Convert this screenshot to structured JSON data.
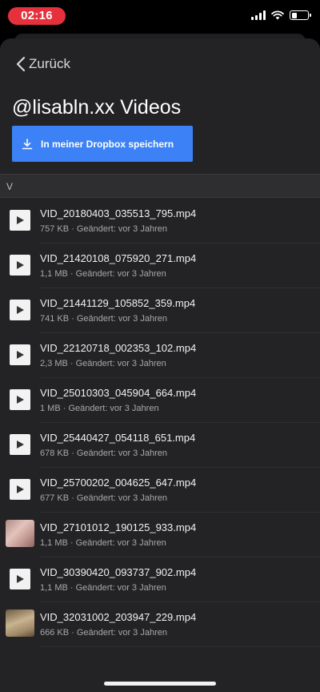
{
  "status_bar": {
    "time": "02:16"
  },
  "nav": {
    "back_label": "Zurück"
  },
  "page": {
    "title": "@lisabln.xx Videos"
  },
  "actions": {
    "save_label": "In meiner Dropbox speichern",
    "accent_color": "#3c82f6"
  },
  "section": {
    "label": "V"
  },
  "files": [
    {
      "name": "VID_20180403_035513_795.mp4",
      "meta": "757 KB · Geändert: vor 3 Jahren",
      "thumb": "play-icon"
    },
    {
      "name": "VID_21420108_075920_271.mp4",
      "meta": "1,1 MB · Geändert: vor 3 Jahren",
      "thumb": "play-icon"
    },
    {
      "name": "VID_21441129_105852_359.mp4",
      "meta": "741 KB · Geändert: vor 3 Jahren",
      "thumb": "play-icon"
    },
    {
      "name": "VID_22120718_002353_102.mp4",
      "meta": "2,3 MB · Geändert: vor 3 Jahren",
      "thumb": "play-icon"
    },
    {
      "name": "VID_25010303_045904_664.mp4",
      "meta": "1 MB · Geändert: vor 3 Jahren",
      "thumb": "play-icon"
    },
    {
      "name": "VID_25440427_054118_651.mp4",
      "meta": "678 KB · Geändert: vor 3 Jahren",
      "thumb": "play-icon"
    },
    {
      "name": "VID_25700202_004625_647.mp4",
      "meta": "677 KB · Geändert: vor 3 Jahren",
      "thumb": "play-icon"
    },
    {
      "name": "VID_27101012_190125_933.mp4",
      "meta": "1,1 MB · Geändert: vor 3 Jahren",
      "thumb": "video-thumbnail"
    },
    {
      "name": "VID_30390420_093737_902.mp4",
      "meta": "1,1 MB · Geändert: vor 3 Jahren",
      "thumb": "play-icon"
    },
    {
      "name": "VID_32031002_203947_229.mp4",
      "meta": "666 KB · Geändert: vor 3 Jahren",
      "thumb": "video-thumbnail"
    }
  ]
}
